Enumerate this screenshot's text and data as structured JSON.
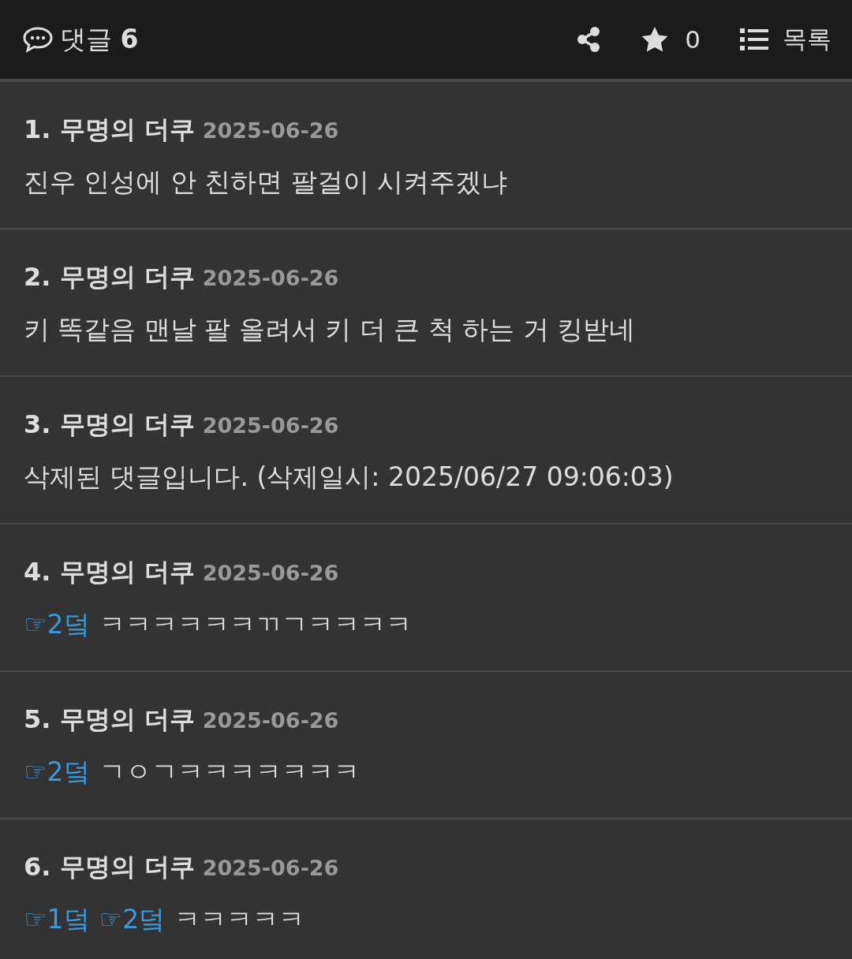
{
  "header": {
    "title": "댓글",
    "count": "6",
    "star_count": "0",
    "list_label": "목록"
  },
  "comments": [
    {
      "number": "1.",
      "author": "무명의 더쿠",
      "date": "2025-06-26",
      "text": "진우 인성에 안 친하면 팔걸이 시켜주겠냐"
    },
    {
      "number": "2.",
      "author": "무명의 더쿠",
      "date": "2025-06-26",
      "text": "키 똑같음 맨날 팔 올려서 키 더 큰 척 하는 거 킹받네"
    },
    {
      "number": "3.",
      "author": "무명의 더쿠",
      "date": "2025-06-26",
      "text": "삭제된 댓글입니다. (삭제일시: 2025/06/27 09:06:03)"
    },
    {
      "number": "4.",
      "author": "무명의 더쿠",
      "date": "2025-06-26",
      "reply_links": [
        "☞2덬"
      ],
      "text": "ㅋㅋㅋㅋㅋㅋㄲㄱㅋㅋㅋㅋ"
    },
    {
      "number": "5.",
      "author": "무명의 더쿠",
      "date": "2025-06-26",
      "reply_links": [
        "☞2덬"
      ],
      "text": "ㄱㅇㄱㅋㅋㅋㅋㅋㅋㅋ"
    },
    {
      "number": "6.",
      "author": "무명의 더쿠",
      "date": "2025-06-26",
      "reply_links": [
        "☞1덬",
        "☞2덬"
      ],
      "text": "ㅋㅋㅋㅋㅋ"
    }
  ]
}
